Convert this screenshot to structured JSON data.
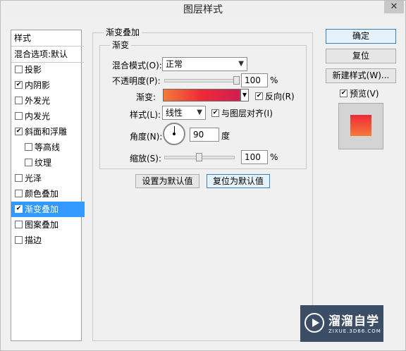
{
  "window": {
    "title": "图层样式",
    "close_glyph": "✕"
  },
  "sidebar": {
    "header": "样式",
    "blend_options": "混合选项:默认",
    "items": [
      {
        "label": "投影",
        "checked": false
      },
      {
        "label": "内阴影",
        "checked": true
      },
      {
        "label": "外发光",
        "checked": false
      },
      {
        "label": "内发光",
        "checked": false
      },
      {
        "label": "斜面和浮雕",
        "checked": true
      },
      {
        "label": "等高线",
        "checked": false
      },
      {
        "label": "纹理",
        "checked": false
      },
      {
        "label": "光泽",
        "checked": false
      },
      {
        "label": "颜色叠加",
        "checked": false
      },
      {
        "label": "渐变叠加",
        "checked": true
      },
      {
        "label": "图案叠加",
        "checked": false
      },
      {
        "label": "描边",
        "checked": false
      }
    ],
    "selected_index": 9
  },
  "gradient_overlay": {
    "group_title": "渐变叠加",
    "sub_title": "渐变",
    "blend_mode": {
      "label": "混合模式(O):",
      "value": "正常"
    },
    "opacity": {
      "label": "不透明度(P):",
      "value": "100",
      "unit": "%",
      "level": 1.0
    },
    "gradient": {
      "label": "渐变:",
      "colors": [
        "#f47a3a",
        "#ee2a38",
        "#d11e52"
      ],
      "reverse": {
        "label": "反向(R)",
        "checked": true
      }
    },
    "style": {
      "label": "样式(L):",
      "value": "线性"
    },
    "align_with_layer": {
      "label": "与图层对齐(I)",
      "checked": true
    },
    "angle": {
      "label": "角度(N):",
      "value": "90",
      "unit": "度"
    },
    "scale": {
      "label": "缩放(S):",
      "value": "100",
      "unit": "%",
      "level": 0.5
    },
    "set_default_label": "设置为默认值",
    "reset_default_label": "复位为默认值"
  },
  "right_panel": {
    "ok_label": "确定",
    "reset_label": "复位",
    "new_style_label": "新建样式(W)...",
    "preview": {
      "label": "预览(V)",
      "checked": true
    }
  },
  "watermark": {
    "name": "溜溜自学",
    "url": "ZIXUE.3D66.COM"
  },
  "icons": {
    "check": "✔",
    "dropdown": "▼"
  }
}
